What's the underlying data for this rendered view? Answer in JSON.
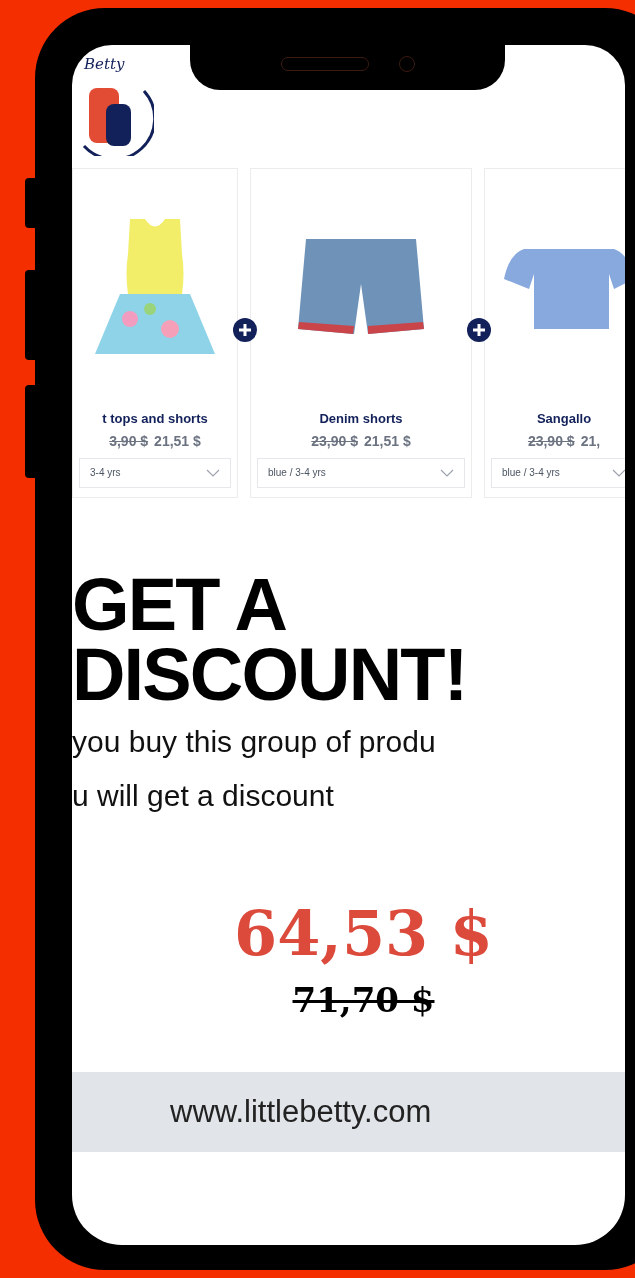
{
  "logo": {
    "text": "Betty"
  },
  "products": [
    {
      "kind": "outfit",
      "title": "t tops and shorts",
      "old_price": "3,90 $",
      "price": "21,51 $",
      "variant": "3-4 yrs"
    },
    {
      "kind": "shorts",
      "title": "Denim shorts",
      "old_price": "23,90 $",
      "price": "21,51 $",
      "variant": "blue / 3-4 yrs"
    },
    {
      "kind": "top",
      "title": "Sangallo",
      "old_price": "23,90 $",
      "price": "21,",
      "variant": "blue / 3-4 yrs"
    }
  ],
  "promo": {
    "headline": [
      "GET A",
      "DISCOUNT!"
    ],
    "lines": [
      "you buy this group of produ",
      "u will get a discount"
    ],
    "price": "64,53 $",
    "old_price": "71,70 $"
  },
  "footer": {
    "url": "www.littlebetty.com"
  }
}
